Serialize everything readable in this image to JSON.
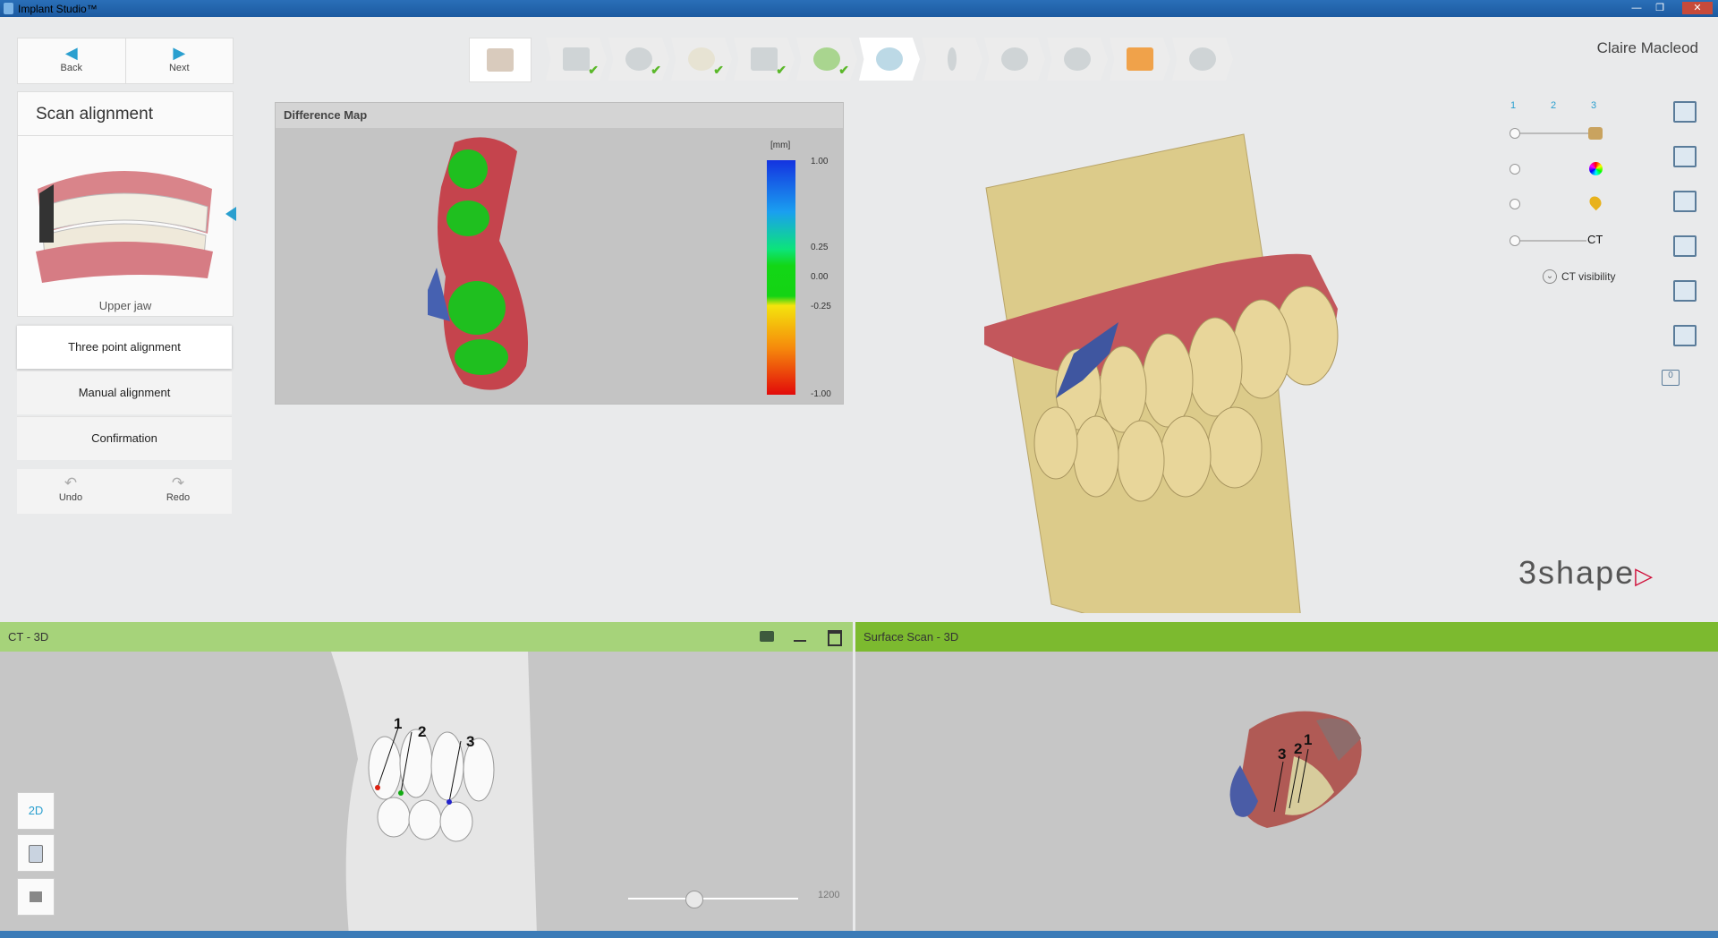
{
  "app": {
    "title": "Implant Studio™",
    "window_buttons": [
      "—",
      "❐",
      "✕"
    ]
  },
  "nav": {
    "back_label": "Back",
    "next_label": "Next"
  },
  "scan_alignment": {
    "title": "Scan alignment",
    "jaw_label": "Upper jaw"
  },
  "steps": [
    {
      "label": "Three point alignment",
      "active": true
    },
    {
      "label": "Manual alignment",
      "active": false
    },
    {
      "label": "Confirmation",
      "active": false
    }
  ],
  "history": {
    "undo_label": "Undo",
    "redo_label": "Redo"
  },
  "toolbar": {
    "items": [
      {
        "icon": "patient-photo-icon",
        "done": false
      },
      {
        "icon": "patient-card-icon",
        "done": true
      },
      {
        "icon": "scan-import-icon",
        "done": true
      },
      {
        "icon": "tooth-icon",
        "done": true
      },
      {
        "icon": "ct-import-icon",
        "done": true
      },
      {
        "icon": "jaw-curve-icon",
        "done": true
      },
      {
        "icon": "scan-alignment-icon",
        "done": false,
        "current": true
      },
      {
        "icon": "implant-icon",
        "done": false
      },
      {
        "icon": "sleeve-icon",
        "done": false
      },
      {
        "icon": "guide-tool-icon",
        "done": false
      },
      {
        "icon": "collaboration-icon",
        "done": false
      },
      {
        "icon": "export-disc-icon",
        "done": false
      }
    ]
  },
  "user_name": "Claire Macleod",
  "difference_map": {
    "title": "Difference Map",
    "unit": "[mm]",
    "ticks": [
      "1.00",
      "0.25",
      "0.00",
      "-0.25",
      "-1.00"
    ]
  },
  "view_controls": {
    "layer_numbers": [
      "1",
      "2",
      "3"
    ],
    "ct_label": "CT",
    "ct_visibility_label": "CT visibility",
    "view_badge": "0"
  },
  "brand": "3shape",
  "ct_pane": {
    "title": "CT - 3D",
    "mode_label": "2D",
    "slider_value": "1200",
    "points": [
      "1",
      "2",
      "3"
    ]
  },
  "surface_pane": {
    "title": "Surface Scan - 3D",
    "points": [
      "3",
      "2",
      "1"
    ]
  },
  "colors": {
    "pane_header_ct": "#a6d37a",
    "pane_header_surface": "#7cba2f",
    "accent": "#2a9fcf"
  }
}
